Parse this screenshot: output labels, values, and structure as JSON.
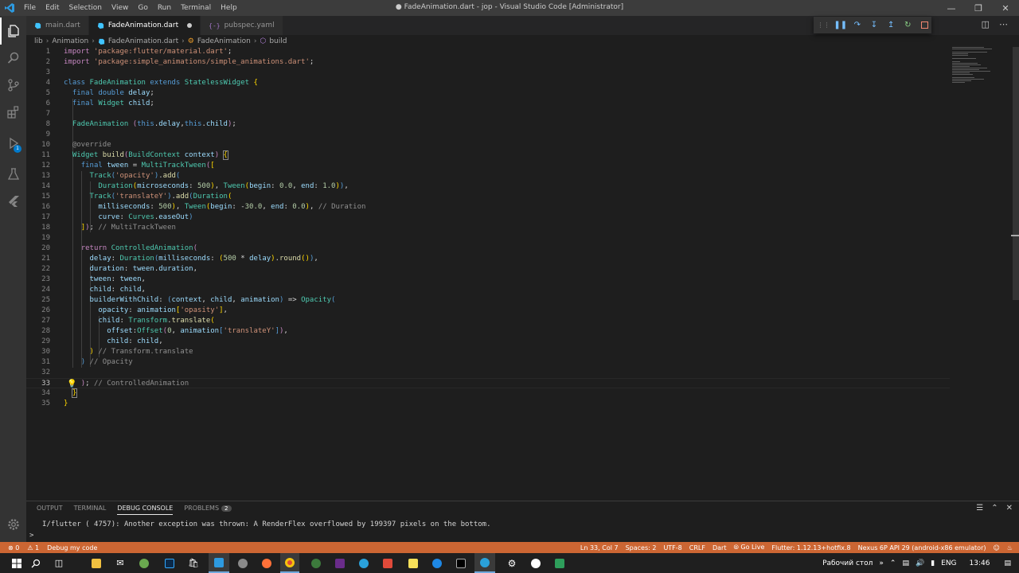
{
  "titlebar": {
    "menu": [
      "File",
      "Edit",
      "Selection",
      "View",
      "Go",
      "Run",
      "Terminal",
      "Help"
    ],
    "window_title": "● FadeAnimation.dart - jop - Visual Studio Code [Administrator]"
  },
  "tabs": [
    {
      "label": "main.dart",
      "icon": "dart-icon"
    },
    {
      "label": "FadeAnimation.dart",
      "icon": "dart-icon",
      "modified": true
    },
    {
      "label": "pubspec.yaml",
      "icon": "yaml-icon"
    }
  ],
  "breadcrumb": [
    "lib",
    "Animation",
    "FadeAnimation.dart",
    "FadeAnimation",
    "build"
  ],
  "activity_badges": {
    "source_control": "1",
    "run": "1"
  },
  "panel": {
    "tabs": [
      "OUTPUT",
      "TERMINAL",
      "DEBUG CONSOLE",
      "PROBLEMS"
    ],
    "problems_count": "2",
    "console_text": "I/flutter ( 4757): Another exception was thrown: A RenderFlex overflowed by 199397 pixels on the bottom.",
    "prompt": ">"
  },
  "statusbar": {
    "errors": "⊗ 0",
    "warnings": "⚠ 1",
    "debug": "Debug my code",
    "position": "Ln 33, Col 7",
    "spaces": "Spaces: 2",
    "encoding": "UTF-8",
    "eol": "CRLF",
    "language": "Dart",
    "golive": "Go Live",
    "flutter": "Flutter: 1.12.13+hotfix.8",
    "device": "Nexus 6P API 29 (android-x86 emulator)"
  },
  "tray": {
    "desktop": "Рабочий стол",
    "lang": "ENG",
    "time": "13:46"
  },
  "colors": {
    "statusbar": "#cc6633",
    "editor_bg": "#1e1e1e",
    "activity_bg": "#333333"
  }
}
